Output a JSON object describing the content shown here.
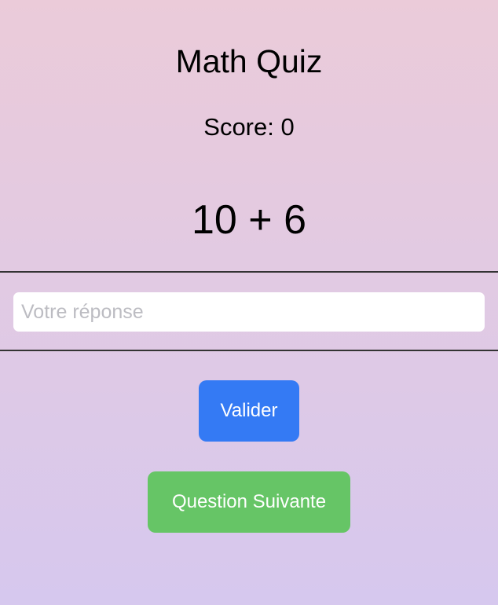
{
  "app": {
    "title": "Math Quiz"
  },
  "score": {
    "text": "Score: 0"
  },
  "question": {
    "text": "10 + 6"
  },
  "answer": {
    "value": "",
    "placeholder": "Votre réponse"
  },
  "buttons": {
    "validate_label": "Valider",
    "next_label": "Question Suivante"
  },
  "colors": {
    "background_top": "#ebcbd9",
    "background_bottom": "#d6c8ee",
    "validate_button": "#347af4",
    "next_button": "#66c566",
    "divider": "#333333"
  }
}
